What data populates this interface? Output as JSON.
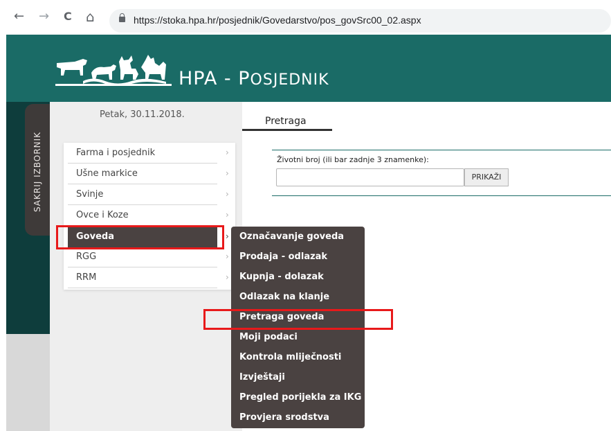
{
  "browser": {
    "url": "https://stoka.hpa.hr/posjednik/Govedarstvo/pos_govSrc00_02.aspx",
    "back_icon": "←",
    "forward_icon": "→",
    "reload_icon": "C",
    "home_icon": "⌂"
  },
  "header": {
    "title_prefix": "HPA - ",
    "title_initial": "P",
    "title_rest": "OSJEDNIK"
  },
  "sidebar": {
    "hide_label": "SAKRIJ IZBORNIK",
    "date": "Petak, 30.11.2018.",
    "chevron": "›",
    "items": [
      {
        "label": "Farma i posjednik"
      },
      {
        "label": "Ušne markice"
      },
      {
        "label": "Svinje"
      },
      {
        "label": "Ovce i Koze"
      },
      {
        "label": "Goveda"
      },
      {
        "label": "RGG"
      },
      {
        "label": "RRM"
      }
    ]
  },
  "submenu": {
    "items": [
      {
        "label": "Označavanje goveda"
      },
      {
        "label": "Prodaja - odlazak"
      },
      {
        "label": "Kupnja - dolazak"
      },
      {
        "label": "Odlazak na klanje"
      },
      {
        "label": "Pretraga goveda"
      },
      {
        "label": "Moji podaci"
      },
      {
        "label": "Kontrola mliječnosti"
      },
      {
        "label": "Izvještaji"
      },
      {
        "label": "Pregled porijekla za IKG"
      },
      {
        "label": "Provjera srodstva"
      }
    ]
  },
  "main": {
    "tab_label": "Pretraga",
    "field_label": "Životni broj (ili bar zadnje 3 znamenke):",
    "field_value": "",
    "button_label": "PRIKAŽI"
  },
  "colors": {
    "header_teal": "#1a6b66",
    "dark_menu": "#4a4241",
    "highlight_red": "#e8191a"
  }
}
